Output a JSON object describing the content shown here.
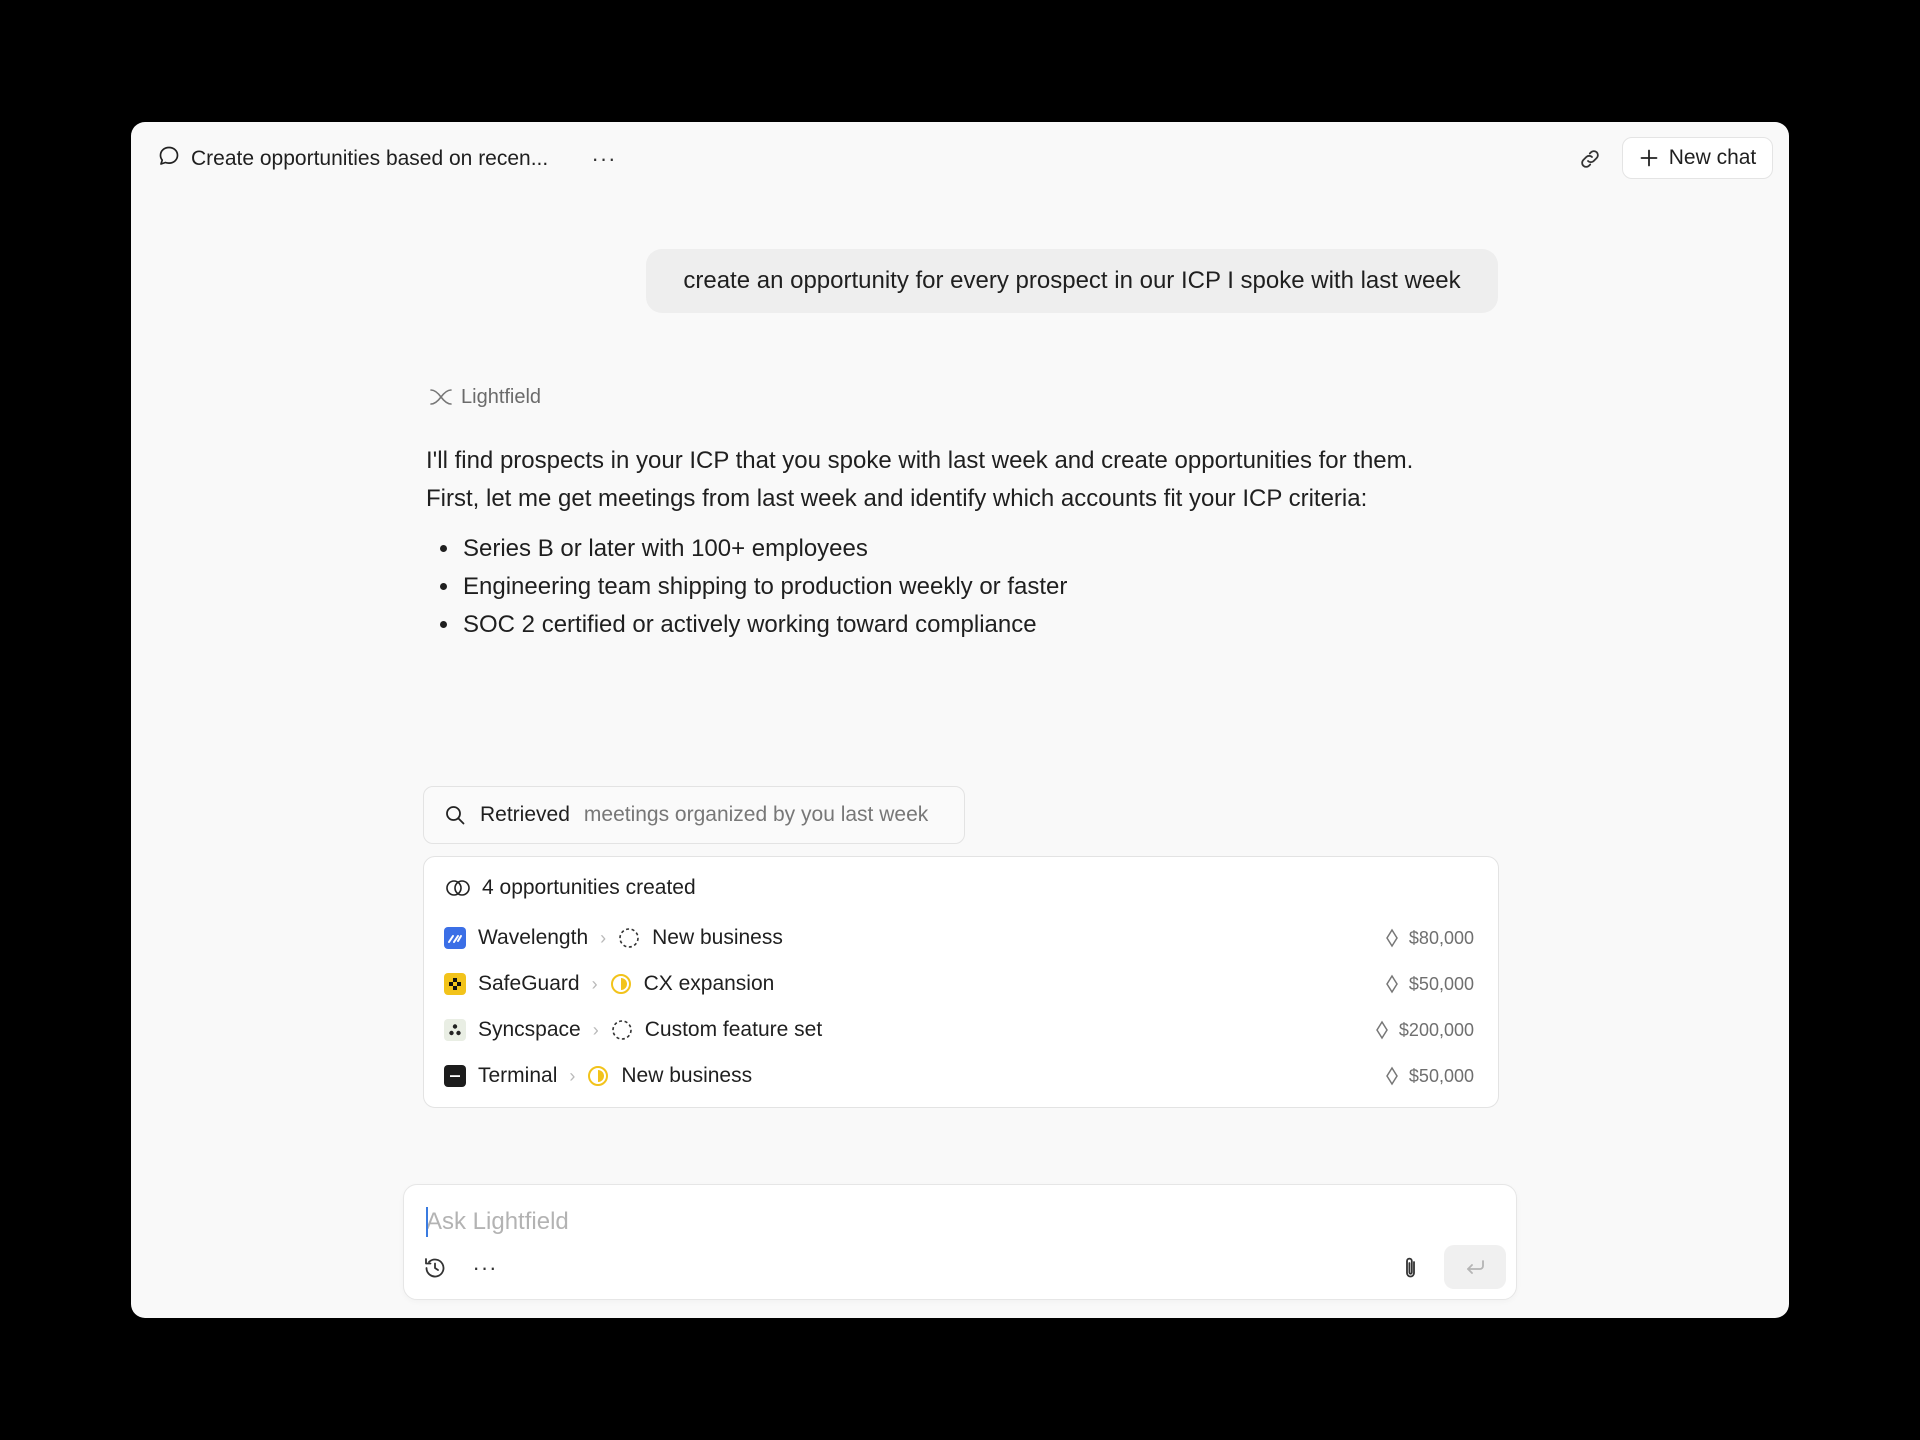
{
  "header": {
    "chat_title": "Create opportunities based on recen...",
    "more_label": "···",
    "new_chat_label": "New chat"
  },
  "user_message": "create an opportunity for every prospect in our ICP I spoke with last week",
  "assistant": {
    "name": "Lightfield",
    "intro_line1": "I'll find prospects in your ICP that you spoke with last week and create opportunities for them.",
    "intro_line2": "First, let me get meetings from last week and identify which accounts fit your ICP criteria:",
    "criteria": [
      "Series B or later with 100+ employees",
      "Engineering team shipping to production weekly or faster",
      "SOC 2 certified or actively working toward compliance"
    ]
  },
  "retrieved": {
    "label": "Retrieved",
    "detail": "meetings organized by you last week"
  },
  "opportunities": {
    "summary": "4 opportunities created",
    "rows": [
      {
        "company": "Wavelength",
        "stage": "New business",
        "amount": "$80,000"
      },
      {
        "company": "SafeGuard",
        "stage": "CX expansion",
        "amount": "$50,000"
      },
      {
        "company": "Syncspace",
        "stage": "Custom feature set",
        "amount": "$200,000"
      },
      {
        "company": "Terminal",
        "stage": "New business",
        "amount": "$50,000"
      }
    ]
  },
  "composer": {
    "placeholder": "Ask Lightfield",
    "more_label": "···"
  },
  "colors": {
    "accent_blue": "#3b6fe6",
    "status_yellow": "#f2c31b",
    "background": "#f9f9f9"
  }
}
